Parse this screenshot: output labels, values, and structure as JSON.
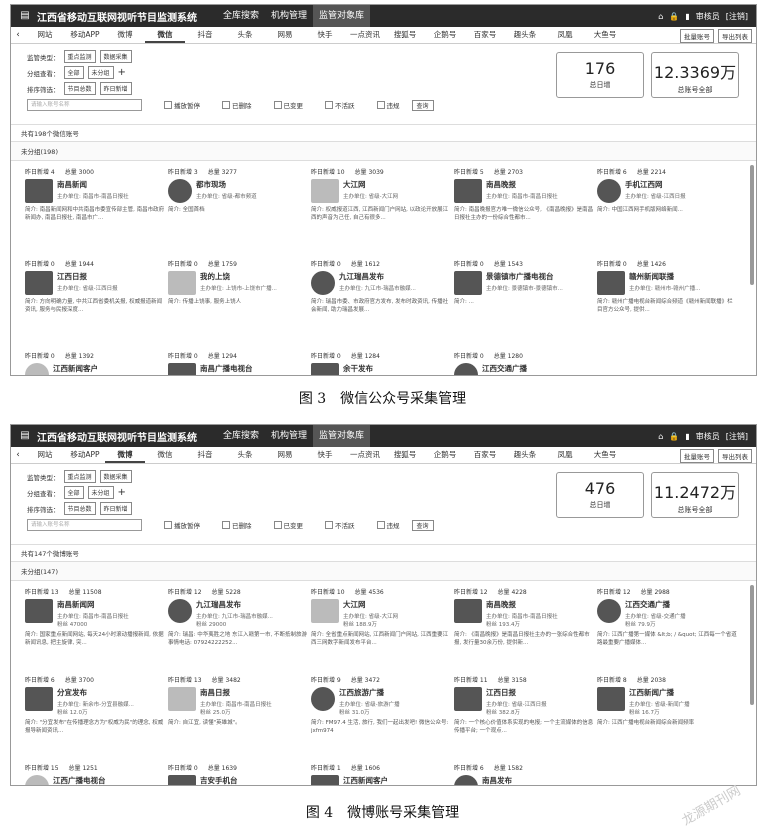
{
  "app": {
    "title": "江西省移动互联网视听节目监测系统",
    "nav": [
      "全库搜索",
      "机构管理",
      "监管对象库"
    ],
    "user": "审核员",
    "logout": "[注销]"
  },
  "tabs": [
    "网站",
    "移动APP",
    "微博",
    "微信",
    "抖音",
    "头条",
    "网易",
    "快手",
    "一点资讯",
    "搜狐号",
    "企鹅号",
    "百家号",
    "趣头条",
    "凤凰",
    "大鱼号"
  ],
  "tab_buttons": [
    "批量账号",
    "导出列表"
  ],
  "filters": {
    "type_label": "监管类型：",
    "type_chips": [
      "重点监测",
      "数据采集"
    ],
    "group_label": "分组查看：",
    "group_chips": [
      "全部",
      "未分组"
    ],
    "sort_label": "排序筛选：",
    "sort_chips": [
      "节目总数",
      "昨日新增"
    ],
    "search_placeholder": "请输入账号名称",
    "checkboxes": [
      "播放暂停",
      "已删除",
      "已变更",
      "不活跃",
      "违规"
    ],
    "query_button": "查询"
  },
  "screens": [
    {
      "today_count": "176",
      "today_label": "总日增",
      "total_count": "12.3369万",
      "total_label": "总账号全部",
      "count_line": "共有198个微信账号",
      "group_head": "未分组(198)",
      "active_tab": "微信",
      "cards": [
        {
          "new": "昨日新增 4",
          "total": "总量 3000",
          "name": "南昌新闻",
          "unit": "主办单位: 南昌市-南昌日报社",
          "desc": "简介: 南昌新闻网和中共南昌市委宣传部主管, 南昌市政府新闻办, 南昌日报社, 南昌市广..."
        },
        {
          "new": "昨日新增 3",
          "total": "总量 3277",
          "name": "都市现场",
          "unit": "主办单位: 省级-都市频道",
          "desc": "简介: 全国首档"
        },
        {
          "new": "昨日新增 10",
          "total": "总量 3039",
          "name": "大江网",
          "unit": "主办单位: 省级-大江网",
          "desc": "简介: 权威报道江西, 江西新闻门户网站, 以政论开放展江西的声音为己任, 自己有很多..."
        },
        {
          "new": "昨日新增 5",
          "total": "总量 2703",
          "name": "南昌晚报",
          "unit": "主办单位: 南昌市-南昌日报社",
          "desc": "简介: 南昌晚报官方唯一微信公众号, 《南昌晚报》是南昌日报社主办的一份综合性都市..."
        },
        {
          "new": "昨日新增 6",
          "total": "总量 2214",
          "name": "手机江西网",
          "unit": "主办单位: 省级-江西日报",
          "desc": "简介: 中国江西网手机版网络新闻..."
        },
        {
          "new": "昨日新增 0",
          "total": "总量 1944",
          "name": "江西日报",
          "unit": "主办单位: 省级-江西日报",
          "desc": "简介: 方向明确力量, 中共江西省委机关报, 权威报道新闻资讯, 服务与民报深度..."
        },
        {
          "new": "昨日新增 0",
          "total": "总量 1759",
          "name": "我的上饶",
          "unit": "主办单位: 上饶市-上饶市广播...",
          "desc": "简介: 传播上饶事, 服务上饶人"
        },
        {
          "new": "昨日新增 0",
          "total": "总量 1612",
          "name": "九江瑞昌发布",
          "unit": "主办单位: 九江市-瑞昌市融媒...",
          "desc": "简介: 瑞昌市委、市政府官方发布, 发布时政资讯, 传播社会新闻, 助力瑞昌发展..."
        },
        {
          "new": "昨日新增 0",
          "total": "总量 1543",
          "name": "景德镇市广播电视台",
          "unit": "主办单位: 景德镇市-景德镇市...",
          "desc": "简介: ..."
        },
        {
          "new": "昨日新增 0",
          "total": "总量 1426",
          "name": "赣州新闻联播",
          "unit": "主办单位: 赣州市-赣州广播...",
          "desc": "简介: 赣州广播电视台新闻综合频道《赣州新闻联播》栏目官方公众号, 提供..."
        },
        {
          "new": "昨日新增 0",
          "total": "总量 1392",
          "name": "江西新闻客户",
          "unit": "",
          "desc": ""
        },
        {
          "new": "昨日新增 0",
          "total": "总量 1294",
          "name": "南昌广播电视台",
          "unit": "",
          "desc": ""
        },
        {
          "new": "昨日新增 0",
          "total": "总量 1284",
          "name": "余干发布",
          "unit": "",
          "desc": ""
        },
        {
          "new": "昨日新增 0",
          "total": "总量 1280",
          "name": "江西交通广播",
          "unit": "",
          "desc": ""
        }
      ]
    },
    {
      "today_count": "476",
      "today_label": "总日增",
      "total_count": "11.2472万",
      "total_label": "总账号全部",
      "count_line": "共有147个微博账号",
      "group_head": "未分组(147)",
      "active_tab": "微博",
      "cards": [
        {
          "new": "昨日新增 13",
          "total": "总量 11508",
          "name": "南昌新闻网",
          "unit": "主办单位: 南昌市-南昌日报社",
          "fans": "粉丝 47000",
          "desc": "简介: 国家重点新闻网站, 每天24小时滚动播报新闻, 依据新闻讯息, 把主旋律, 突..."
        },
        {
          "new": "昨日新增 12",
          "total": "总量 5228",
          "name": "九江瑞昌发布",
          "unit": "主办单位: 九江市-瑞昌市融媒...",
          "fans": "粉丝 29000",
          "desc": "简介: 瑞昌: 中华夷胜之地 东江入赣第一市, 不断抵制旅游事情电话: 07924222252..."
        },
        {
          "new": "昨日新增 10",
          "total": "总量 4536",
          "name": "大江网",
          "unit": "主办单位: 省级-大江网",
          "fans": "粉丝 188.9万",
          "desc": "简介: 全省重点新闻网站, 江西新闻门户网站, 江西重要江西三网数字新闻发布平台..."
        },
        {
          "new": "昨日新增 12",
          "total": "总量 4228",
          "name": "南昌晚报",
          "unit": "主办单位: 南昌市-南昌日报社",
          "fans": "粉丝 193.4万",
          "desc": "简介: 《南昌晚报》是南昌日报社主办的一张综合性都市报, 发行量30余万份, 提供新..."
        },
        {
          "new": "昨日新增 12",
          "total": "总量 2988",
          "name": "江西交通广播",
          "unit": "主办单位: 省级-交通广播",
          "fans": "粉丝 79.9万",
          "desc": "简介: 江西广播第一媒体 &lt;b; / &quot; 江西每一个省道路最重要广播媒体..."
        },
        {
          "new": "昨日新增 6",
          "total": "总量 3700",
          "name": "分宜发布",
          "unit": "主办单位: 新余市-分宜县融媒...",
          "fans": "粉丝 12.0万",
          "desc": "简介: \"分宜发布\"在传播理念方为\"权威为民\"的理念, 权威报导新闻资讯..."
        },
        {
          "new": "昨日新增 13",
          "total": "总量 3482",
          "name": "南昌日报",
          "unit": "主办单位: 南昌市-南昌日报社",
          "fans": "粉丝 25.0万",
          "desc": "简介: 自江宜, 读懂\"英雄城\"。"
        },
        {
          "new": "昨日新增 9",
          "total": "总量 3472",
          "name": "江西旅游广播",
          "unit": "主办单位: 省级-旅游广播",
          "fans": "粉丝 31.0万",
          "desc": "简介: FM97.4 生活, 旅行, 我们一起出发吧! 微信公众号: jxfm974"
        },
        {
          "new": "昨日新增 11",
          "total": "总量 3158",
          "name": "江西日报",
          "unit": "主办单位: 省级-江西日报",
          "fans": "粉丝 382.8万",
          "desc": "简介: 一个核心价值体系实现的电报; 一个主流媒体的信息传播平台; 一个观点..."
        },
        {
          "new": "昨日新增 8",
          "total": "总量 2038",
          "name": "江西新闻广播",
          "unit": "主办单位: 省级-新闻广播",
          "fans": "粉丝 16.7万",
          "desc": "简介: 江西广播电视台新闻综合新闻频率"
        },
        {
          "new": "昨日新增 15",
          "total": "总量 1251",
          "name": "江西广播电视台",
          "unit": "",
          "fans": "",
          "desc": ""
        },
        {
          "new": "昨日新增 0",
          "total": "总量 1639",
          "name": "吉安手机台",
          "unit": "",
          "fans": "",
          "desc": ""
        },
        {
          "new": "昨日新增 1",
          "total": "总量 1606",
          "name": "江西新闻客户",
          "unit": "",
          "fans": "",
          "desc": ""
        },
        {
          "new": "昨日新增 6",
          "total": "总量 1582",
          "name": "南昌发布",
          "unit": "",
          "fans": "",
          "desc": ""
        }
      ]
    }
  ],
  "captions": [
    "图 3　微信公众号采集管理",
    "图 4　微博账号采集管理"
  ],
  "watermark": "龙源期刊网"
}
